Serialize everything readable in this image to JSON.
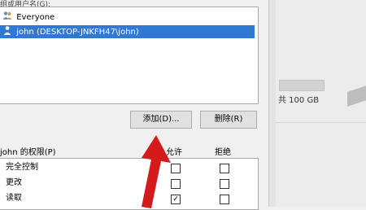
{
  "dialog": {
    "groups_label": "组或用户名(G):",
    "users": [
      {
        "name": "Everyone",
        "icon": "group-icon",
        "selected": false
      },
      {
        "name": "john (DESKTOP-JNKFH47\\john)",
        "icon": "user-icon",
        "selected": true
      }
    ],
    "add_button": "添加(D)...",
    "remove_button": "删除(R)",
    "permissions_label": "john 的权限(P)",
    "columns": {
      "allow": "允许",
      "deny": "拒绝"
    },
    "permissions": [
      {
        "name": "完全控制",
        "allow": false,
        "deny": false
      },
      {
        "name": "更改",
        "allow": false,
        "deny": false
      },
      {
        "name": "读取",
        "allow": true,
        "deny": false
      }
    ],
    "accent_color": "#2f78d4",
    "arrow_color": "#d41a1a"
  },
  "background_window": {
    "size_text": "共 100 GB"
  }
}
